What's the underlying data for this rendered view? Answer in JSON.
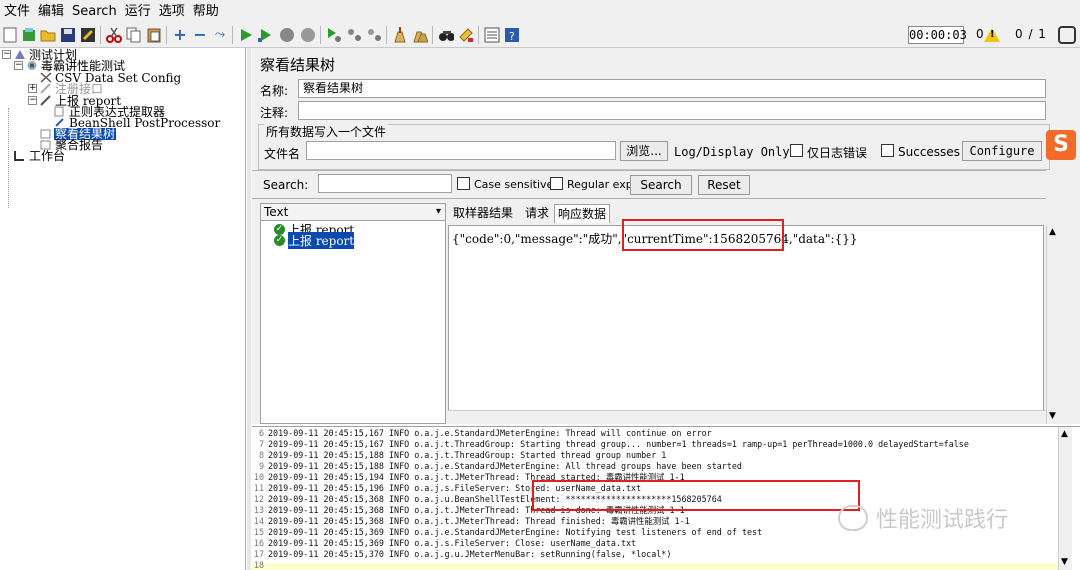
{
  "menubar": {
    "items": [
      "文件",
      "编辑",
      "Search",
      "运行",
      "选项",
      "帮助"
    ]
  },
  "toolbar": {
    "icons": [
      "new-icon",
      "templates-icon",
      "open-icon",
      "save-icon",
      "save-as-icon",
      "cut-icon",
      "copy-icon",
      "paste-icon",
      "expand-icon",
      "collapse-icon",
      "toggle-icon",
      "start-icon",
      "start-no-pause-icon",
      "stop-icon",
      "shutdown-icon",
      "remote-start-icon",
      "remote-stop-icon",
      "remote-shutdown-icon",
      "clear-icon",
      "clear-all-icon",
      "search-icon",
      "reset-search-icon",
      "function-helper-icon",
      "help-icon"
    ],
    "timer": "00:00:03",
    "warning_count": "0",
    "thread_count": "0 / 1"
  },
  "tree": {
    "nodes": [
      {
        "label": "测试计划",
        "icon": "test-plan-icon"
      },
      {
        "label": "毒霸讲性能测试",
        "icon": "thread-group-icon"
      },
      {
        "label": "CSV Data Set Config",
        "icon": "config-icon"
      },
      {
        "label": "注册接口",
        "icon": "sampler-icon"
      },
      {
        "label": "上报 report",
        "icon": "sampler-icon"
      },
      {
        "label": "正则表达式提取器",
        "icon": "extractor-icon"
      },
      {
        "label": "BeanShell PostProcessor",
        "icon": "postprocessor-icon"
      },
      {
        "label": "察看结果树",
        "icon": "listener-icon"
      },
      {
        "label": "聚合报告",
        "icon": "report-icon"
      },
      {
        "label": "工作台",
        "icon": "workbench-icon"
      }
    ]
  },
  "main": {
    "title": "察看结果树",
    "name_label": "名称:",
    "name_value": "察看结果树",
    "comment_label": "注释:",
    "file_group_title": "所有数据写入一个文件",
    "filename_label": "文件名",
    "browse_button": "浏览...",
    "log_display_label": "Log/Display Only:",
    "errors_label": "仅日志错误",
    "successes_label": "Successes",
    "configure_button": "Configure",
    "search_label": "Search:",
    "case_sensitive_label": "Case sensitive",
    "regex_label": "Regular exp.",
    "search_button": "Search",
    "reset_button": "Reset",
    "renderer": "Text",
    "results": [
      "上报 report",
      "上报 report"
    ],
    "tabs": [
      "取样器结果",
      "请求",
      "响应数据"
    ],
    "response_text": "{\"code\":0,\"message\":\"成功\",\"currentTime\":1568205764,\"data\":{}}"
  },
  "log": {
    "lines": [
      {
        "num": "6",
        "text": "2019-09-11 20:45:15,167 INFO o.a.j.e.StandardJMeterEngine: Thread will continue on error"
      },
      {
        "num": "7",
        "text": "2019-09-11 20:45:15,167 INFO o.a.j.t.ThreadGroup: Starting thread group... number=1 threads=1 ramp-up=1 perThread=1000.0 delayedStart=false"
      },
      {
        "num": "8",
        "text": "2019-09-11 20:45:15,188 INFO o.a.j.t.ThreadGroup: Started thread group number 1"
      },
      {
        "num": "9",
        "text": "2019-09-11 20:45:15,188 INFO o.a.j.e.StandardJMeterEngine: All thread groups have been started"
      },
      {
        "num": "10",
        "text": "2019-09-11 20:45:15,194 INFO o.a.j.t.JMeterThread: Thread started: 毒霸讲性能测试 1-1"
      },
      {
        "num": "11",
        "text": "2019-09-11 20:45:15,196 INFO o.a.j.s.FileServer: Stored: userName_data.txt"
      },
      {
        "num": "12",
        "text": "2019-09-11 20:45:15,368 INFO o.a.j.u.BeanShellTestElement: *********************1568205764"
      },
      {
        "num": "13",
        "text": "2019-09-11 20:45:15,368 INFO o.a.j.t.JMeterThread: Thread is done: 毒霸讲性能测试 1-1"
      },
      {
        "num": "14",
        "text": "2019-09-11 20:45:15,368 INFO o.a.j.t.JMeterThread: Thread finished: 毒霸讲性能测试 1-1"
      },
      {
        "num": "15",
        "text": "2019-09-11 20:45:15,369 INFO o.a.j.e.StandardJMeterEngine: Notifying test listeners of end of test"
      },
      {
        "num": "16",
        "text": "2019-09-11 20:45:15,369 INFO o.a.j.s.FileServer: Close: userName_data.txt"
      },
      {
        "num": "17",
        "text": "2019-09-11 20:45:15,370 INFO o.a.j.g.u.JMeterMenuBar: setRunning(false, *local*)"
      },
      {
        "num": "18",
        "text": ""
      }
    ]
  },
  "watermark": {
    "text": "性能测试践行"
  },
  "ime": {
    "glyph": "S"
  }
}
